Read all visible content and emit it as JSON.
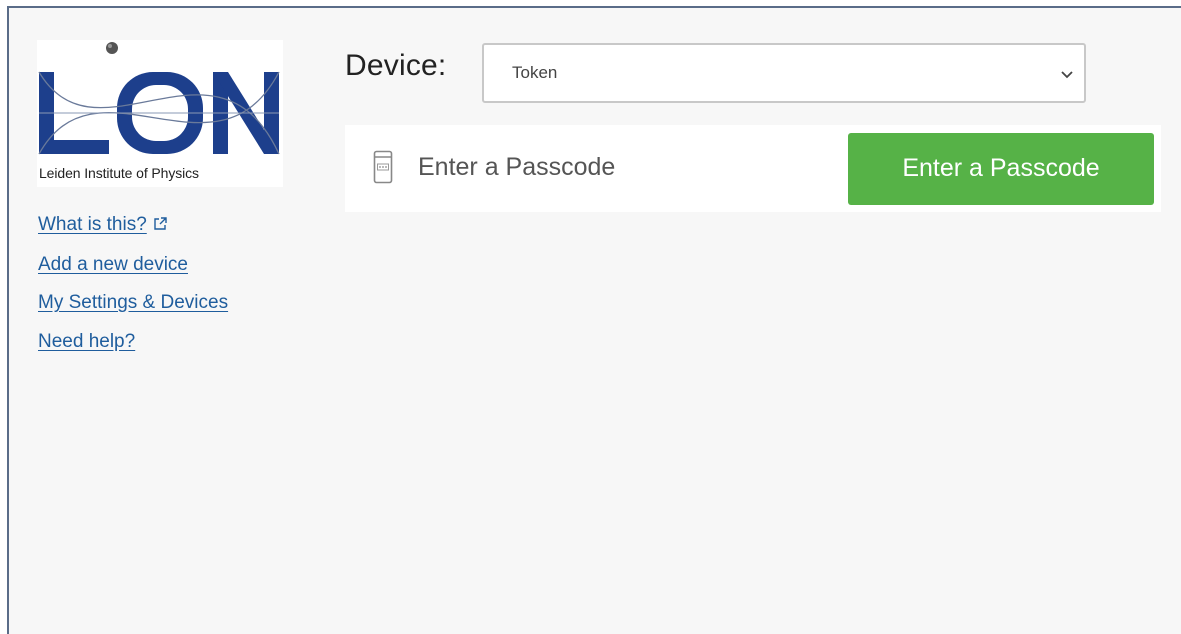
{
  "logo": {
    "caption": "Leiden Institute of Physics",
    "colors": {
      "blue": "#1d3f8c",
      "sphere": "#555555"
    }
  },
  "sidebar": {
    "links": [
      {
        "label": "What is this?",
        "icon": "external-link-icon"
      },
      {
        "label": "Add a new device"
      },
      {
        "label": "My Settings & Devices"
      },
      {
        "label": "Need help?"
      }
    ]
  },
  "device": {
    "label": "Device:",
    "selected": "Token",
    "icon": "chevron-down-icon"
  },
  "passcode": {
    "icon": "token-device-icon",
    "label": "Enter a Passcode",
    "button_label": "Enter a Passcode",
    "button_color": "#56b247"
  }
}
